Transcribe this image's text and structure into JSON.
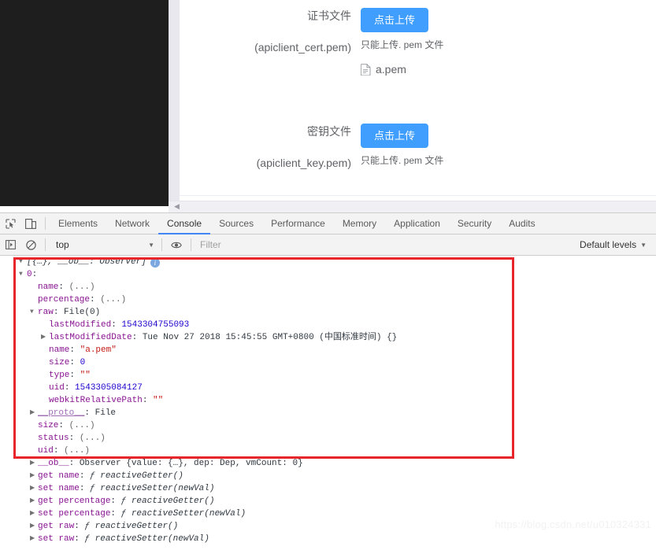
{
  "page": {
    "rows": [
      {
        "label": "证书文件",
        "label_sub": "(apiclient_cert.pem)",
        "button": "点击上传",
        "tip": "只能上传. pem 文件",
        "file": "a.pem"
      },
      {
        "label": "密钥文件",
        "label_sub": "(apiclient_key.pem)",
        "button": "点击上传",
        "tip": "只能上传. pem 文件",
        "file": ""
      }
    ],
    "accent_color": "#409eff"
  },
  "devtools": {
    "tabs": [
      "Elements",
      "Network",
      "Console",
      "Sources",
      "Performance",
      "Memory",
      "Application",
      "Security",
      "Audits"
    ],
    "active_tab": "Console",
    "context": "top",
    "filter_placeholder": "Filter",
    "filter_value": "",
    "levels": "Default levels",
    "active_tab_underline_color": "#4285f4",
    "highlight_box_color": "#e8252a"
  },
  "console": {
    "lines": [
      {
        "indent": 0,
        "arrow": "open",
        "text": "[{…}, __ob__: Observer]",
        "style": "array",
        "info": true
      },
      {
        "indent": 1,
        "arrow": "open",
        "key": "0",
        "value": "",
        "style": "index"
      },
      {
        "indent": 2,
        "arrow": "blank",
        "key": "name",
        "value": "(...)",
        "style": "dim"
      },
      {
        "indent": 2,
        "arrow": "blank",
        "key": "percentage",
        "value": "(...)",
        "style": "dim"
      },
      {
        "indent": 2,
        "arrow": "open",
        "key": "raw",
        "value": "File(0)",
        "style": "plain"
      },
      {
        "indent": 3,
        "arrow": "blank",
        "key": "lastModified",
        "value": "1543304755093",
        "style": "num"
      },
      {
        "indent": 3,
        "arrow": "closed",
        "key": "lastModifiedDate",
        "value": "Tue Nov 27 2018 15:45:55 GMT+0800 (中国标准时间) {}",
        "style": "plain"
      },
      {
        "indent": 3,
        "arrow": "blank",
        "key": "name",
        "value": "\"a.pem\"",
        "style": "str"
      },
      {
        "indent": 3,
        "arrow": "blank",
        "key": "size",
        "value": "0",
        "style": "num"
      },
      {
        "indent": 3,
        "arrow": "blank",
        "key": "type",
        "value": "\"\"",
        "style": "str"
      },
      {
        "indent": 3,
        "arrow": "blank",
        "key": "uid",
        "value": "1543305084127",
        "style": "num"
      },
      {
        "indent": 3,
        "arrow": "blank",
        "key": "webkitRelativePath",
        "value": "\"\"",
        "style": "str"
      },
      {
        "indent": 2,
        "arrow": "closed",
        "key": "__proto__",
        "value": "File",
        "style": "proto"
      },
      {
        "indent": 2,
        "arrow": "blank",
        "key": "size",
        "value": "(...)",
        "style": "dim"
      },
      {
        "indent": 2,
        "arrow": "blank",
        "key": "status",
        "value": "(...)",
        "style": "dim"
      },
      {
        "indent": 2,
        "arrow": "blank",
        "key": "uid",
        "value": "(...)",
        "style": "dim"
      },
      {
        "indent": 2,
        "arrow": "closed",
        "key": "__ob__",
        "value": "Observer {value: {…}, dep: Dep, vmCount: 0}",
        "style": "plain"
      },
      {
        "indent": 2,
        "arrow": "closed",
        "key": "get name",
        "value": "ƒ reactiveGetter()",
        "style": "fn"
      },
      {
        "indent": 2,
        "arrow": "closed",
        "key": "set name",
        "value": "ƒ reactiveSetter(newVal)",
        "style": "fn"
      },
      {
        "indent": 2,
        "arrow": "closed",
        "key": "get percentage",
        "value": "ƒ reactiveGetter()",
        "style": "fn"
      },
      {
        "indent": 2,
        "arrow": "closed",
        "key": "set percentage",
        "value": "ƒ reactiveSetter(newVal)",
        "style": "fn"
      },
      {
        "indent": 2,
        "arrow": "closed",
        "key": "get raw",
        "value": "ƒ reactiveGetter()",
        "style": "fn"
      },
      {
        "indent": 2,
        "arrow": "closed",
        "key": "set raw",
        "value": "ƒ reactiveSetter(newVal)",
        "style": "fn"
      }
    ]
  },
  "watermark": "https://blog.csdn.net/u010324331"
}
